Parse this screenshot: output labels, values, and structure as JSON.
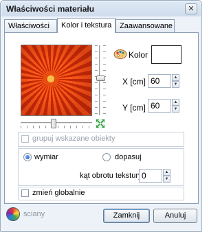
{
  "window": {
    "title": "Właściwości materiału",
    "close_glyph": "✕"
  },
  "tabs": [
    {
      "label": "Właściwości"
    },
    {
      "label": "Kolor i tekstura"
    },
    {
      "label": "Zaawansowane"
    }
  ],
  "color": {
    "label": "Kolor",
    "swatch": "#ffffff"
  },
  "x_field": {
    "label": "X [cm]",
    "value": "60"
  },
  "y_field": {
    "label": "Y [cm]",
    "value": "60"
  },
  "group_checkbox": {
    "label": "grupuj wskazane obiekty",
    "checked": false,
    "enabled": false
  },
  "fit": {
    "option_wymiar": "wymiar",
    "option_dopasuj": "dopasuj",
    "selected": "wymiar",
    "rotation_label": "kąt obrotu tekstury",
    "rotation_value": "0"
  },
  "global_checkbox": {
    "label": "zmień globalnie",
    "checked": false
  },
  "footer": {
    "material_name": "sciany",
    "close_label": "Zamknij",
    "cancel_label": "Anuluj"
  },
  "icons": {
    "close": "close-icon",
    "palette": "palette-icon",
    "expand": "expand-icon",
    "material": "material-sphere-icon",
    "spin_up": "▲",
    "spin_down": "▼"
  },
  "sliders": {
    "texture_scale_vertical": 0.45,
    "texture_scale_horizontal": 0.47
  }
}
